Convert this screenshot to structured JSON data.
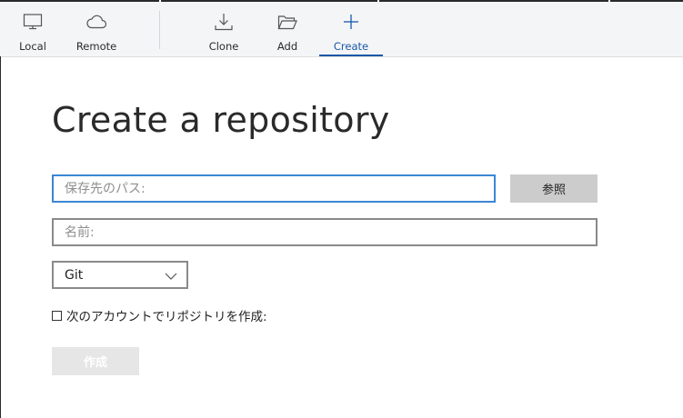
{
  "toolbar": {
    "items": [
      {
        "label": "Local",
        "icon": "monitor-icon"
      },
      {
        "label": "Remote",
        "icon": "cloud-icon"
      },
      {
        "label": "Clone",
        "icon": "download-icon"
      },
      {
        "label": "Add",
        "icon": "folder-open-icon"
      },
      {
        "label": "Create",
        "icon": "plus-icon",
        "active": true
      }
    ],
    "accent": "#1a58a8"
  },
  "page": {
    "title": "Create a repository"
  },
  "form": {
    "path": {
      "value": "",
      "placeholder": "保存先のパス:"
    },
    "browse_label": "参照",
    "name": {
      "value": "",
      "placeholder": "名前:"
    },
    "vcs": {
      "selected": "Git"
    },
    "account_checkbox": {
      "label": "次のアカウントでリポジトリを作成:",
      "checked": false
    },
    "create_label": "作成"
  }
}
